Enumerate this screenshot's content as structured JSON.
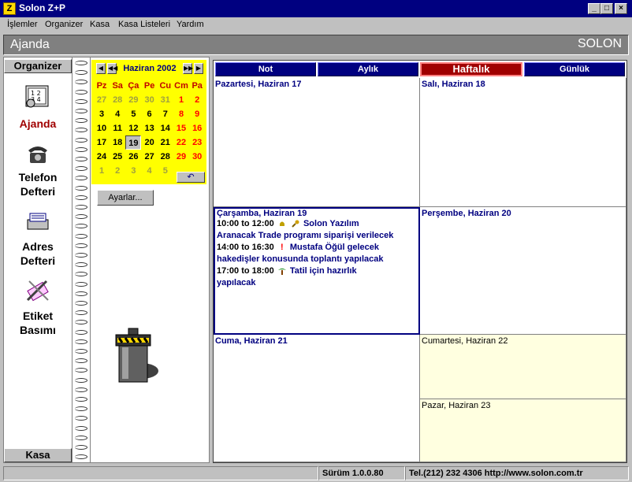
{
  "window": {
    "title": "Solon Z+P",
    "app_icon_letter": "Z"
  },
  "menu": [
    "İşlemler",
    "Organizer",
    "Kasa",
    "Kasa Listeleri",
    "Yardım"
  ],
  "header": {
    "title": "Ajanda",
    "brand": "SOLON"
  },
  "leftnav": {
    "top_header": "Organizer",
    "bottom_header": "Kasa",
    "items": [
      {
        "label": "Ajanda",
        "icon": "calendar-icon"
      },
      {
        "label1": "Telefon",
        "label2": "Defteri",
        "icon": "telephone-icon"
      },
      {
        "label1": "Adres",
        "label2": "Defteri",
        "icon": "address-book-icon"
      },
      {
        "label1": "Etiket",
        "label2": "Basımı",
        "icon": "label-print-icon"
      }
    ]
  },
  "calendar": {
    "month_label": "Haziran 2002",
    "dow": [
      "Pz",
      "Sa",
      "Ça",
      "Pe",
      "Cu",
      "Cm",
      "Pa"
    ],
    "weeks": [
      [
        [
          "27",
          "o"
        ],
        [
          "28",
          "o"
        ],
        [
          "29",
          "o"
        ],
        [
          "30",
          "o"
        ],
        [
          "31",
          "o"
        ],
        [
          "1",
          "w"
        ],
        [
          "2",
          "w"
        ]
      ],
      [
        [
          "3",
          "c"
        ],
        [
          "4",
          "c"
        ],
        [
          "5",
          "c"
        ],
        [
          "6",
          "c"
        ],
        [
          "7",
          "c"
        ],
        [
          "8",
          "w"
        ],
        [
          "9",
          "w"
        ]
      ],
      [
        [
          "10",
          "c"
        ],
        [
          "11",
          "c"
        ],
        [
          "12",
          "c"
        ],
        [
          "13",
          "c"
        ],
        [
          "14",
          "c"
        ],
        [
          "15",
          "w"
        ],
        [
          "16",
          "w"
        ]
      ],
      [
        [
          "17",
          "c"
        ],
        [
          "18",
          "c"
        ],
        [
          "19",
          "t"
        ],
        [
          "20",
          "c"
        ],
        [
          "21",
          "c"
        ],
        [
          "22",
          "w"
        ],
        [
          "23",
          "w"
        ]
      ],
      [
        [
          "24",
          "c"
        ],
        [
          "25",
          "c"
        ],
        [
          "26",
          "c"
        ],
        [
          "27",
          "c"
        ],
        [
          "28",
          "c"
        ],
        [
          "29",
          "w"
        ],
        [
          "30",
          "w"
        ]
      ],
      [
        [
          "1",
          "o"
        ],
        [
          "2",
          "o"
        ],
        [
          "3",
          "o"
        ],
        [
          "4",
          "o"
        ],
        [
          "5",
          "o"
        ]
      ]
    ],
    "undo_symbol": "↶"
  },
  "settings_button": "Ayarlar...",
  "tabs": [
    "Not",
    "Aylık",
    "Haftalık",
    "Günlük"
  ],
  "active_tab": "Haftalık",
  "days": {
    "mon": "Pazartesi, Haziran 17",
    "tue": "Salı, Haziran 18",
    "wed": "Çarşamba, Haziran 19",
    "thu": "Perşembe, Haziran 20",
    "fri": "Cuma, Haziran 21",
    "sat": "Cumartesi, Haziran 22",
    "sun": "Pazar, Haziran 23"
  },
  "events": {
    "e1_time": "10:00  to 12:00",
    "e1_title": "Solon Yazılım",
    "e1_desc": "Aranacak Trade programı siparişi verilecek",
    "e2_time": "14:00  to 16:30",
    "e2_title": "Mustafa Öğül gelecek",
    "e2_desc": "hakedişler konusunda toplantı yapılacak",
    "e3_time": "17:00  to 18:00",
    "e3_title": "Tatil için hazırlık",
    "e3_desc": "yapılacak"
  },
  "status": {
    "version": "Sürüm 1.0.0.80",
    "contact": "Tel.(212) 232 4306  http://www.solon.com.tr"
  }
}
